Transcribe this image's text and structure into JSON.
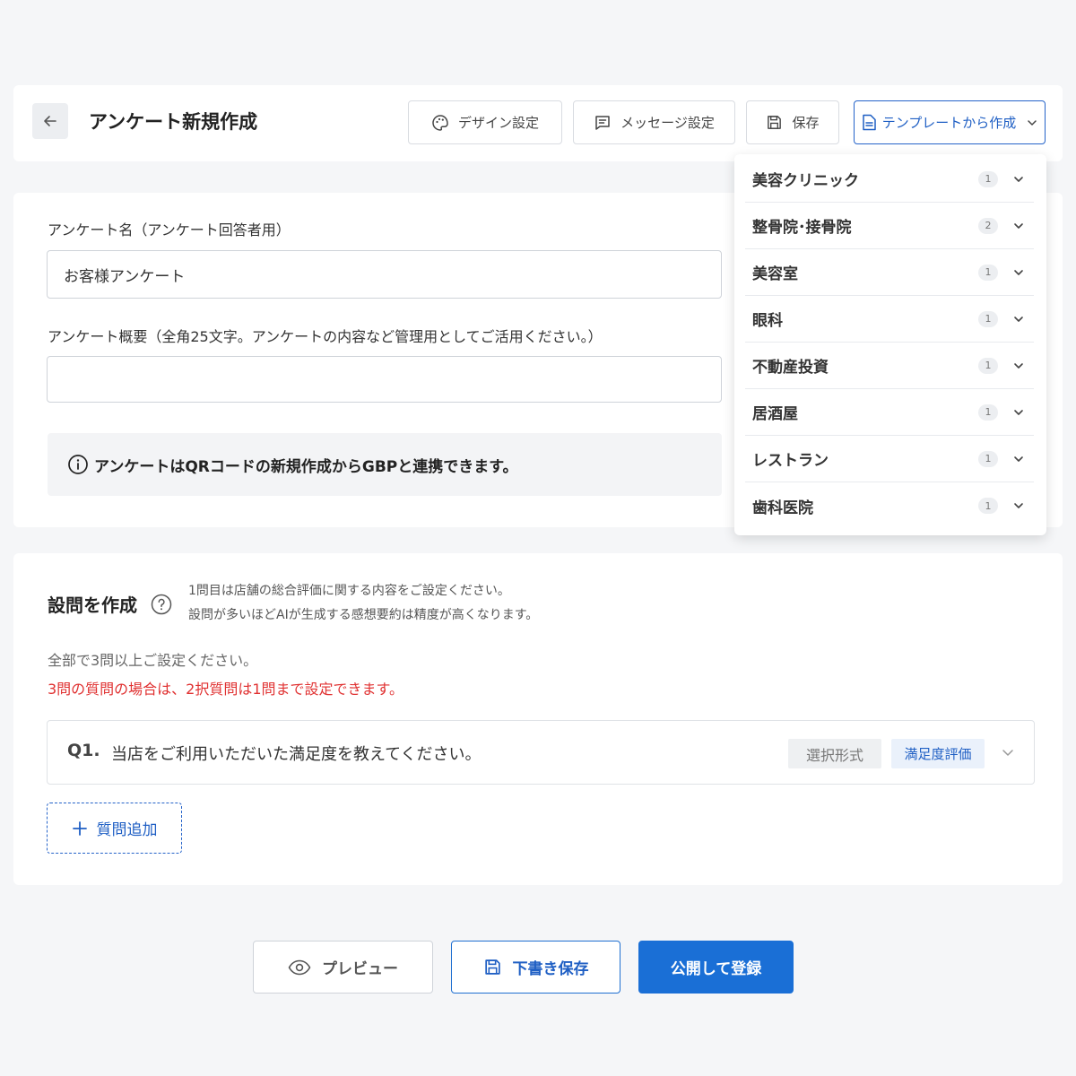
{
  "header": {
    "title": "アンケート新規作成",
    "design_label": "デザイン設定",
    "message_label": "メッセージ設定",
    "save_label": "保存",
    "template_label": "テンプレートから作成"
  },
  "form": {
    "name_label": "アンケート名（アンケート回答者用）",
    "name_value": "お客様アンケート",
    "summary_label": "アンケート概要（全角25文字。アンケートの内容など管理用としてご活用ください。）",
    "summary_value": "",
    "info_text": "アンケートはQRコードの新規作成からGBPと連携できます。"
  },
  "template_menu": {
    "items": [
      {
        "label": "美容クリニック",
        "count": "1"
      },
      {
        "label": "整骨院･接骨院",
        "count": "2"
      },
      {
        "label": "美容室",
        "count": "1"
      },
      {
        "label": "眼科",
        "count": "1"
      },
      {
        "label": "不動産投資",
        "count": "1"
      },
      {
        "label": "居酒屋",
        "count": "1"
      },
      {
        "label": "レストラン",
        "count": "1"
      },
      {
        "label": "歯科医院",
        "count": "1"
      }
    ]
  },
  "questions": {
    "title": "設問を作成",
    "hint_line1": "1問目は店舗の総合評価に関する内容をご設定ください。",
    "hint_line2": "設問が多いほどAIが生成する感想要約は精度が高くなります。",
    "all_note": "全部で3問以上ご設定ください。",
    "warn_note": "3問の質問の場合は、2択質問は1問まで設定できます。",
    "items": [
      {
        "number": "Q1.",
        "text": "当店をご利用いただいた満足度を教えてください。",
        "type": "選択形式",
        "category": "満足度評価"
      }
    ],
    "add_label": "質問追加"
  },
  "footer": {
    "preview_label": "プレビュー",
    "draft_label": "下書き保存",
    "publish_label": "公開して登録"
  },
  "colors": {
    "accent": "#1a6fd6",
    "warning": "#e03131"
  }
}
